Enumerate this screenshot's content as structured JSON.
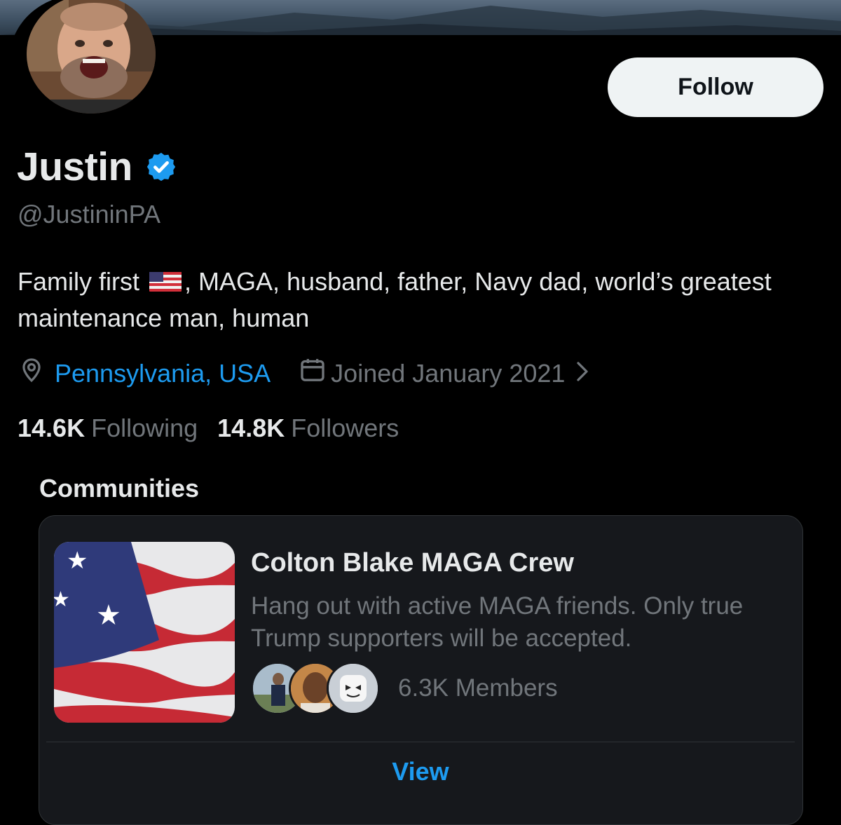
{
  "profile": {
    "name": "Justin",
    "handle": "@JustininPA",
    "bio_before_flag": "Family first ",
    "bio_after_flag": ", MAGA, husband, father, Navy dad, world’s greatest maintenance man, human",
    "location": "Pennsylvania, USA",
    "joined": "Joined January 2021",
    "following_count": "14.6K",
    "following_label": "Following",
    "followers_count": "14.8K",
    "followers_label": "Followers"
  },
  "actions": {
    "follow_label": "Follow"
  },
  "communities": {
    "section_title": "Communities",
    "items": [
      {
        "name": "Colton Blake MAGA Crew",
        "description": "Hang out with active MAGA friends. Only true Trump supporters will be accepted.",
        "members": "6.3K Members",
        "view_label": "View"
      }
    ]
  },
  "icons": {
    "verified": "verified-badge-icon",
    "location": "location-pin-icon",
    "calendar": "calendar-icon",
    "chevron": "chevron-right-icon"
  },
  "colors": {
    "background": "#000000",
    "primary_text": "#e7e9ea",
    "secondary_text": "#71767b",
    "accent": "#1d9bf0",
    "card_bg": "#16181c"
  }
}
